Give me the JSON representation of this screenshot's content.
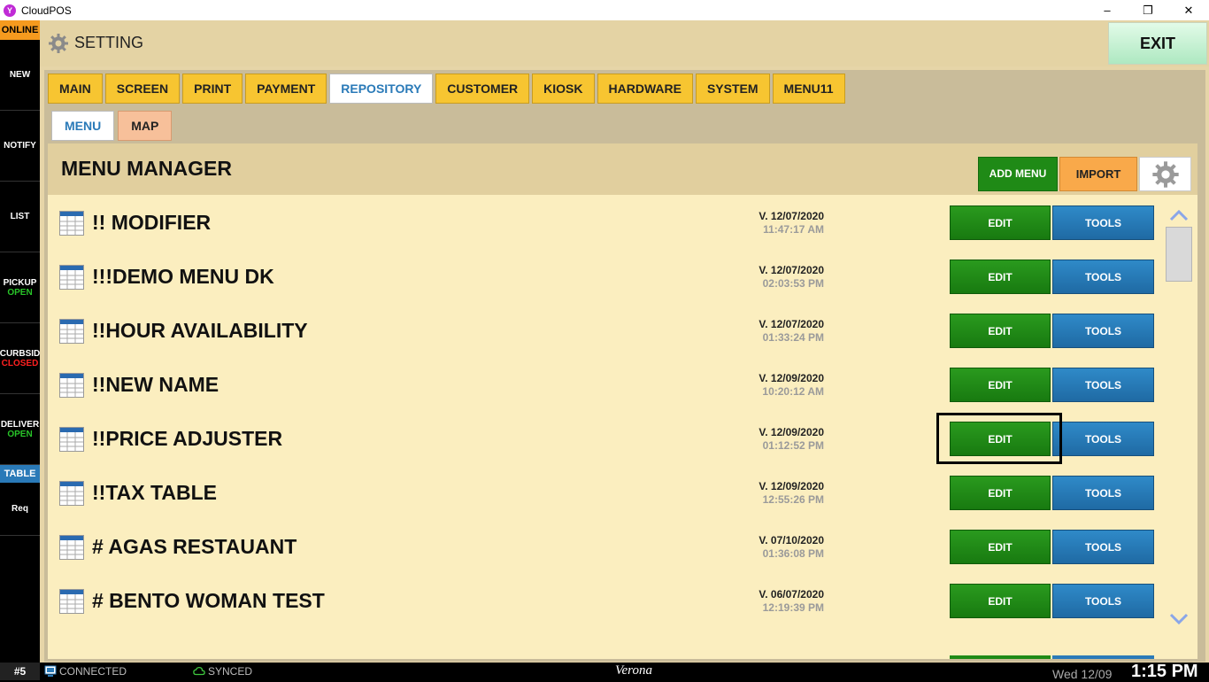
{
  "window": {
    "app_logo": "Y",
    "title": "CloudPOS",
    "minimize": "–",
    "restore": "❐",
    "close": "✕"
  },
  "rail": {
    "online": "ONLINE",
    "items": [
      {
        "label": "NEW",
        "status": ""
      },
      {
        "label": "NOTIFY",
        "status": ""
      },
      {
        "label": "LIST",
        "status": ""
      },
      {
        "label": "PICKUP",
        "status": "OPEN"
      },
      {
        "label": "CURBSID",
        "status": "CLOSED"
      },
      {
        "label": "DELIVER",
        "status": "OPEN"
      }
    ],
    "table": "TABLE",
    "req": "Req"
  },
  "header": {
    "title": "SETTING",
    "exit": "EXIT"
  },
  "tabs": [
    "MAIN",
    "SCREEN",
    "PRINT",
    "PAYMENT",
    "REPOSITORY",
    "CUSTOMER",
    "KIOSK",
    "HARDWARE",
    "SYSTEM",
    "MENU11"
  ],
  "active_tab": "REPOSITORY",
  "subtabs": [
    "MENU",
    "MAP"
  ],
  "active_subtab": "MENU",
  "manager": {
    "title": "MENU MANAGER",
    "add_menu": "ADD MENU",
    "import": "IMPORT"
  },
  "menus": [
    {
      "name": "!! MODIFIER",
      "version": "V. 12/07/2020",
      "time": "11:47:17 AM",
      "edit": "EDIT",
      "tools": "TOOLS"
    },
    {
      "name": "!!!DEMO MENU DK",
      "version": "V. 12/07/2020",
      "time": "02:03:53 PM",
      "edit": "EDIT",
      "tools": "TOOLS"
    },
    {
      "name": "!!HOUR AVAILABILITY",
      "version": "V. 12/07/2020",
      "time": "01:33:24 PM",
      "edit": "EDIT",
      "tools": "TOOLS"
    },
    {
      "name": "!!NEW NAME",
      "version": "V. 12/09/2020",
      "time": "10:20:12 AM",
      "edit": "EDIT",
      "tools": "TOOLS"
    },
    {
      "name": "!!PRICE ADJUSTER",
      "version": "V. 12/09/2020",
      "time": "01:12:52 PM",
      "edit": "EDIT",
      "tools": "TOOLS"
    },
    {
      "name": "!!TAX TABLE",
      "version": "V. 12/09/2020",
      "time": "12:55:26 PM",
      "edit": "EDIT",
      "tools": "TOOLS"
    },
    {
      "name": "# AGAS RESTAUANT",
      "version": "V. 07/10/2020",
      "time": "01:36:08 PM",
      "edit": "EDIT",
      "tools": "TOOLS"
    },
    {
      "name": "# BENTO WOMAN TEST",
      "version": "V. 06/07/2020",
      "time": "12:19:39 PM",
      "edit": "EDIT",
      "tools": "TOOLS"
    }
  ],
  "highlighted_row": 4,
  "status": {
    "station": "#5",
    "connected": "CONNECTED",
    "synced": "SYNCED",
    "store": "Verona",
    "date": "Wed 12/09",
    "clock": "1:15 PM"
  },
  "colors": {
    "accent_blue": "#2a7ab8",
    "edit_green": "#1f8a16",
    "tab_yellow": "#f7c531",
    "online_orange": "#f59a1e"
  }
}
